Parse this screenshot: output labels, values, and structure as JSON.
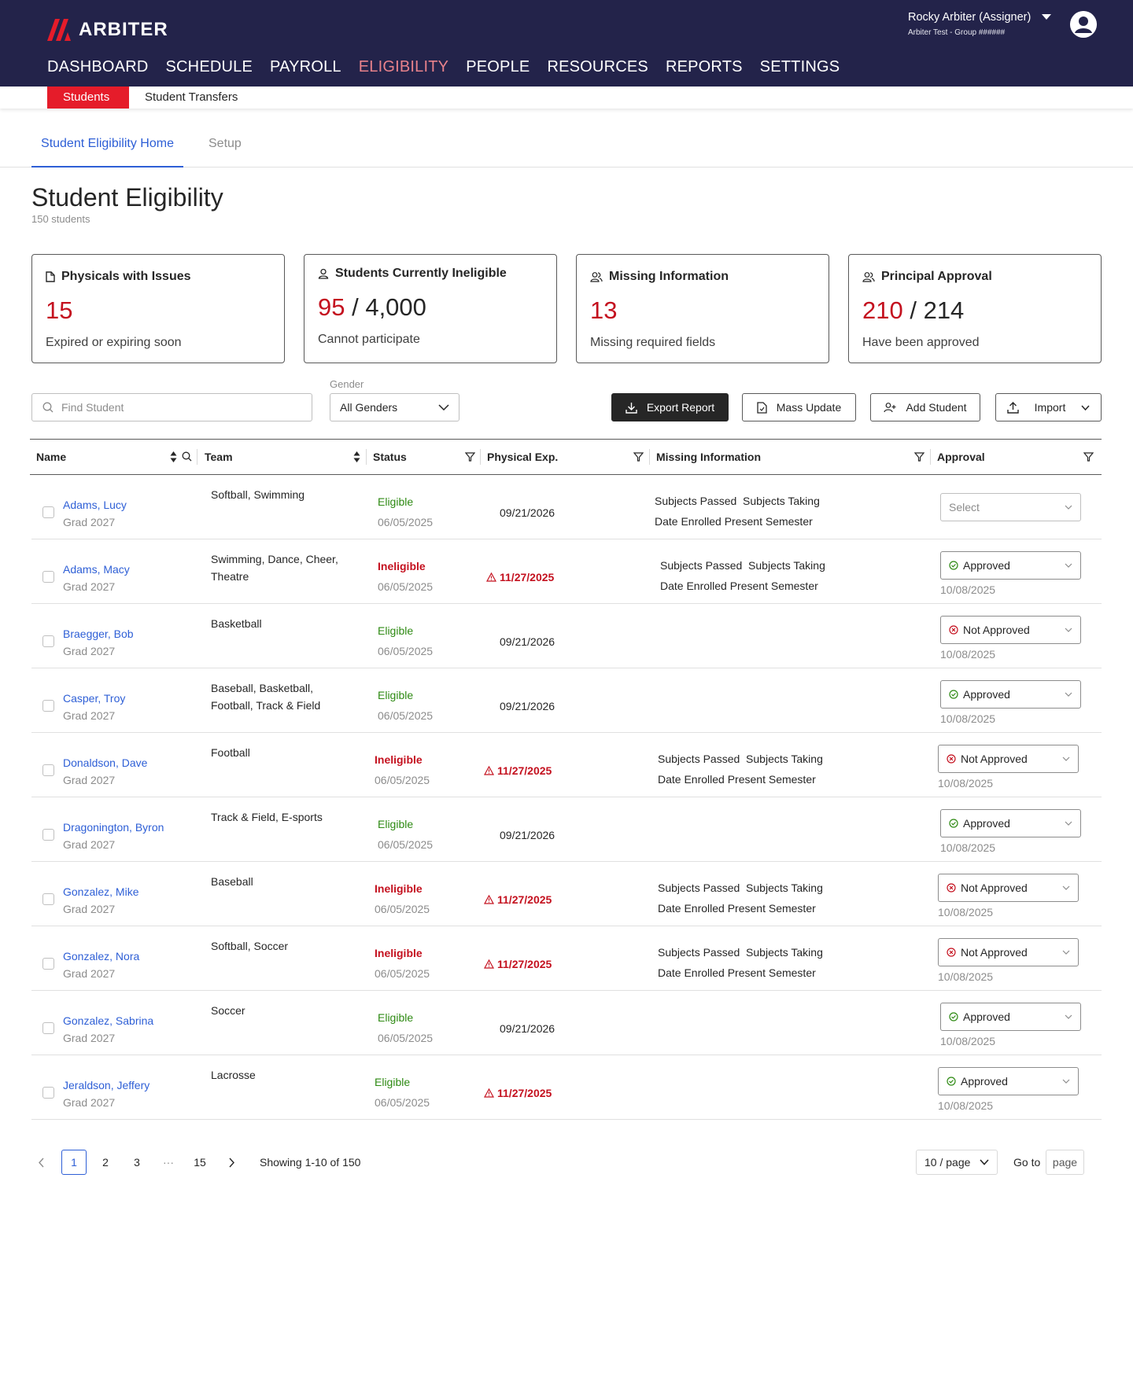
{
  "brand": {
    "name": "ARBITER",
    "accent": "#e51c2a",
    "nav_bg": "#23234a"
  },
  "user": {
    "name": "Rocky Arbiter (Assigner)",
    "group": "Arbiter Test - Group ######"
  },
  "nav": [
    "DASHBOARD",
    "SCHEDULE",
    "PAYROLL",
    "ELIGIBILITY",
    "PEOPLE",
    "RESOURCES",
    "REPORTS",
    "SETTINGS"
  ],
  "nav_active": "ELIGIBILITY",
  "subnav": [
    "Students",
    "Student Transfers"
  ],
  "tabs": [
    "Student Eligibility Home",
    "Setup"
  ],
  "page": {
    "title": "Student Eligibility",
    "subtitle": "150 students"
  },
  "cards": [
    {
      "title": "Physicals with Issues",
      "value_red": "15",
      "value_rest": "",
      "desc": "Expired or expiring soon",
      "icon": "document-icon"
    },
    {
      "title": "Students Currently Ineligible",
      "value_red": "95",
      "value_rest": " / 4,000",
      "desc": "Cannot participate",
      "icon": "person-icon"
    },
    {
      "title": "Missing Information",
      "value_red": "13",
      "value_rest": "",
      "desc": "Missing required fields",
      "icon": "people-icon"
    },
    {
      "title": "Principal Approval",
      "value_red": "210",
      "value_rest": " / 214",
      "desc": "Have been approved",
      "icon": "people-icon"
    }
  ],
  "toolbar": {
    "search_placeholder": "Find Student",
    "gender_label": "Gender",
    "gender_value": "All Genders",
    "export": "Export Report",
    "mass_update": "Mass Update",
    "add_student": "Add Student",
    "import": "Import"
  },
  "table": {
    "columns": [
      "Name",
      "Team",
      "Status",
      "Physical Exp.",
      "Missing Information",
      "Approval"
    ],
    "rows": [
      {
        "name": "Adams, Lucy",
        "grad": "Grad 2027",
        "team": "Softball, Swimming",
        "status": "Eligible",
        "status_date": "06/05/2025",
        "physical": "09/21/2026",
        "physical_warn": false,
        "missing": [
          "Subjects Passed  Subjects Taking",
          "Date Enrolled Present Semester"
        ],
        "approval": "Select",
        "approval_date": ""
      },
      {
        "name": "Adams, Macy",
        "grad": "Grad 2027",
        "team": "Swimming, Dance, Cheer, Theatre",
        "status": "Ineligible",
        "status_date": "06/05/2025",
        "physical": "11/27/2025",
        "physical_warn": true,
        "missing": [
          "Subjects Passed  Subjects Taking",
          "Date Enrolled Present Semester"
        ],
        "approval": "Approved",
        "approval_date": "10/08/2025"
      },
      {
        "name": "Braegger, Bob",
        "grad": "Grad 2027",
        "team": "Basketball",
        "status": "Eligible",
        "status_date": "06/05/2025",
        "physical": "09/21/2026",
        "physical_warn": false,
        "missing": [],
        "approval": "Not Approved",
        "approval_date": "10/08/2025"
      },
      {
        "name": "Casper, Troy",
        "grad": "Grad 2027",
        "team": "Baseball, Basketball, Football, Track & Field",
        "status": "Eligible",
        "status_date": "06/05/2025",
        "physical": "09/21/2026",
        "physical_warn": false,
        "missing": [],
        "approval": "Approved",
        "approval_date": "10/08/2025"
      },
      {
        "name": "Donaldson, Dave",
        "grad": "Grad 2027",
        "team": "Football",
        "status": "Ineligible",
        "status_date": "06/05/2025",
        "physical": "11/27/2025",
        "physical_warn": true,
        "missing": [
          "Subjects Passed  Subjects Taking",
          "Date Enrolled Present Semester"
        ],
        "approval": "Not Approved",
        "approval_date": "10/08/2025"
      },
      {
        "name": "Dragonington, Byron",
        "grad": "Grad 2027",
        "team": "Track & Field, E-sports",
        "status": "Eligible",
        "status_date": "06/05/2025",
        "physical": "09/21/2026",
        "physical_warn": false,
        "missing": [],
        "approval": "Approved",
        "approval_date": "10/08/2025"
      },
      {
        "name": "Gonzalez, Mike",
        "grad": "Grad 2027",
        "team": "Baseball",
        "status": "Ineligible",
        "status_date": "06/05/2025",
        "physical": "11/27/2025",
        "physical_warn": true,
        "missing": [
          "Subjects Passed  Subjects Taking",
          "Date Enrolled Present Semester"
        ],
        "approval": "Not Approved",
        "approval_date": "10/08/2025"
      },
      {
        "name": "Gonzalez, Nora",
        "grad": "Grad 2027",
        "team": "Softball, Soccer",
        "status": "Ineligible",
        "status_date": "06/05/2025",
        "physical": "11/27/2025",
        "physical_warn": true,
        "missing": [
          "Subjects Passed  Subjects Taking",
          "Date Enrolled Present Semester"
        ],
        "approval": "Not Approved",
        "approval_date": "10/08/2025"
      },
      {
        "name": "Gonzalez, Sabrina",
        "grad": "Grad 2027",
        "team": "Soccer",
        "status": "Eligible",
        "status_date": "06/05/2025",
        "physical": "09/21/2026",
        "physical_warn": false,
        "missing": [],
        "approval": "Approved",
        "approval_date": "10/08/2025"
      },
      {
        "name": "Jeraldson, Jeffery",
        "grad": "Grad 2027",
        "team": "Lacrosse",
        "status": "Eligible",
        "status_date": "06/05/2025",
        "physical": "11/27/2025",
        "physical_warn": true,
        "missing": [],
        "approval": "Approved",
        "approval_date": "10/08/2025"
      }
    ]
  },
  "pagination": {
    "pages": [
      "1",
      "2",
      "3",
      "···",
      "15"
    ],
    "current": "1",
    "showing": "Showing 1-10 of 150",
    "per_page": "10 / page",
    "goto_label": "Go to",
    "goto_placeholder": "page"
  }
}
